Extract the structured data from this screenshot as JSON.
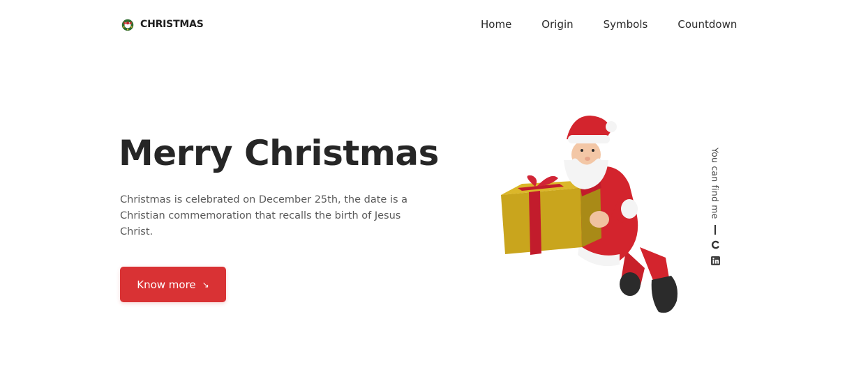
{
  "header": {
    "logo_text": "CHRISTMAS",
    "logo_icon": "wreath-icon",
    "nav": [
      {
        "label": "Home"
      },
      {
        "label": "Origin"
      },
      {
        "label": "Symbols"
      },
      {
        "label": "Countdown"
      }
    ]
  },
  "hero": {
    "title": "Merry Christmas",
    "description": "Christmas is celebrated on December 25th, the date is a Christian commemoration that recalls the birth of Jesus Christ.",
    "cta_label": "Know more",
    "cta_icon": "arrow-down-right-icon",
    "image": "santa-with-gift-illustration"
  },
  "social": {
    "label": "You can find me",
    "icons": [
      "github-icon",
      "linkedin-icon"
    ]
  },
  "colors": {
    "accent": "#d93234",
    "text_dark": "#262626",
    "text_muted": "#5a5a5a",
    "background": "#ffffff"
  }
}
